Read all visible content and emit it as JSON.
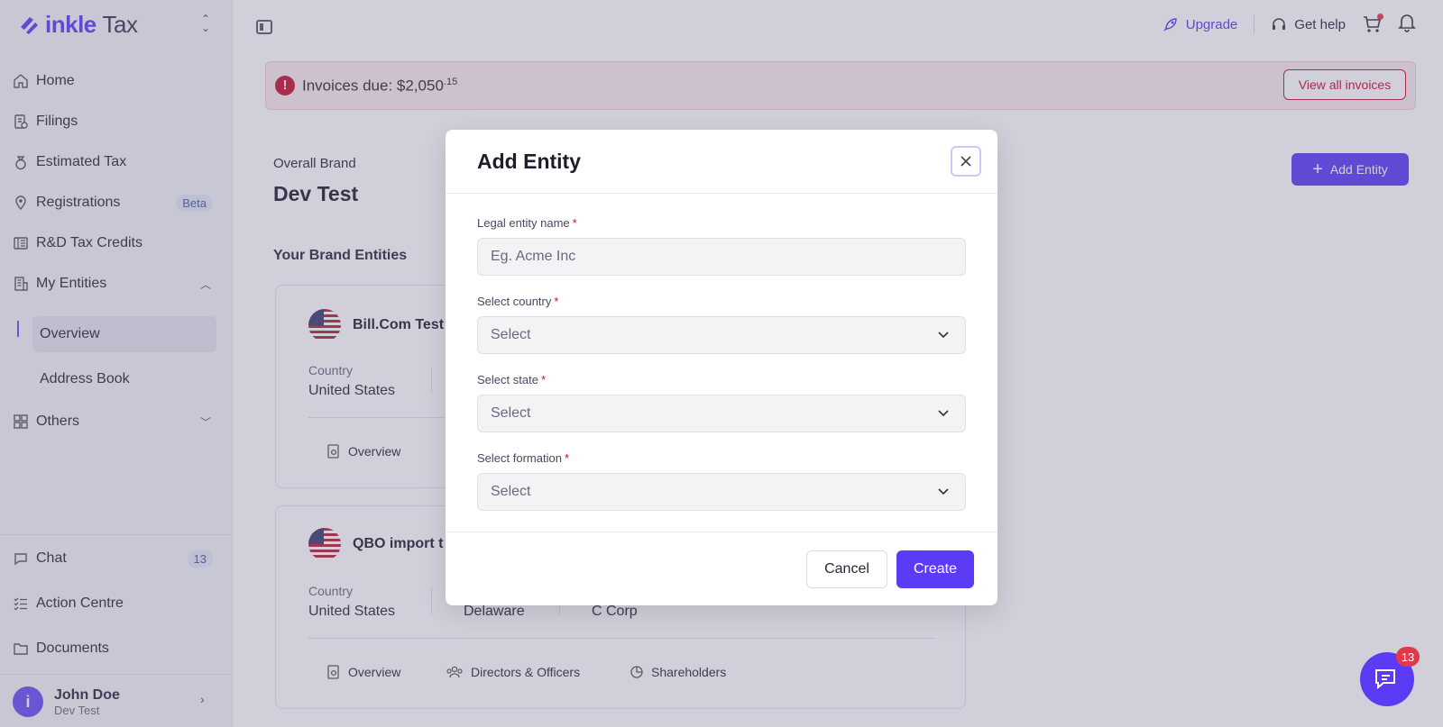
{
  "app": {
    "brand_primary": "inkle",
    "brand_secondary": "Tax",
    "accent_color": "#5b3bf5"
  },
  "sidebar": {
    "items": [
      {
        "label": "Home",
        "icon": "home-icon"
      },
      {
        "label": "Filings",
        "icon": "filings-icon"
      },
      {
        "label": "Estimated Tax",
        "icon": "money-bag-icon"
      },
      {
        "label": "Registrations",
        "icon": "location-pin-icon",
        "badge": "Beta"
      },
      {
        "label": "R&D Tax Credits",
        "icon": "ledger-icon"
      },
      {
        "label": "My Entities",
        "icon": "entities-icon"
      }
    ],
    "sub_items": [
      {
        "label": "Overview",
        "active": true
      },
      {
        "label": "Address Book",
        "active": false
      }
    ],
    "others_label": "Others",
    "bottom_items": [
      {
        "label": "Chat",
        "icon": "chat-icon",
        "badge": "13"
      },
      {
        "label": "Action Centre",
        "icon": "checklist-icon"
      },
      {
        "label": "Documents",
        "icon": "folder-icon"
      }
    ],
    "user": {
      "initial": "i",
      "name": "John Doe",
      "subtitle": "Dev Test"
    }
  },
  "topbar": {
    "upgrade_label": "Upgrade",
    "help_label": "Get help"
  },
  "banner": {
    "text": "Invoices due: $2,050",
    "cents": ".15",
    "button_label": "View all invoices"
  },
  "main": {
    "brand_label": "Overall Brand",
    "brand_name": "Dev Test",
    "add_entity_label": "Add Entity",
    "section_title": "Your Brand Entities",
    "entities": [
      {
        "name": "Bill.Com Test",
        "country_label": "Country",
        "country": "United States",
        "tabs": [
          "Overview"
        ]
      },
      {
        "name": "QBO import t",
        "country_label": "Country",
        "country": "United States",
        "state": "Delaware",
        "formation": "C Corp",
        "tabs": [
          "Overview",
          "Directors & Officers",
          "Shareholders"
        ]
      }
    ]
  },
  "modal": {
    "title": "Add Entity",
    "fields": [
      {
        "label": "Legal entity name",
        "placeholder": "Eg. Acme Inc",
        "type": "text"
      },
      {
        "label": "Select country",
        "value": "Select",
        "type": "select"
      },
      {
        "label": "Select state",
        "value": "Select",
        "type": "select"
      },
      {
        "label": "Select formation",
        "value": "Select",
        "type": "select"
      }
    ],
    "cancel_label": "Cancel",
    "create_label": "Create"
  },
  "chat_fab": {
    "badge": "13"
  }
}
